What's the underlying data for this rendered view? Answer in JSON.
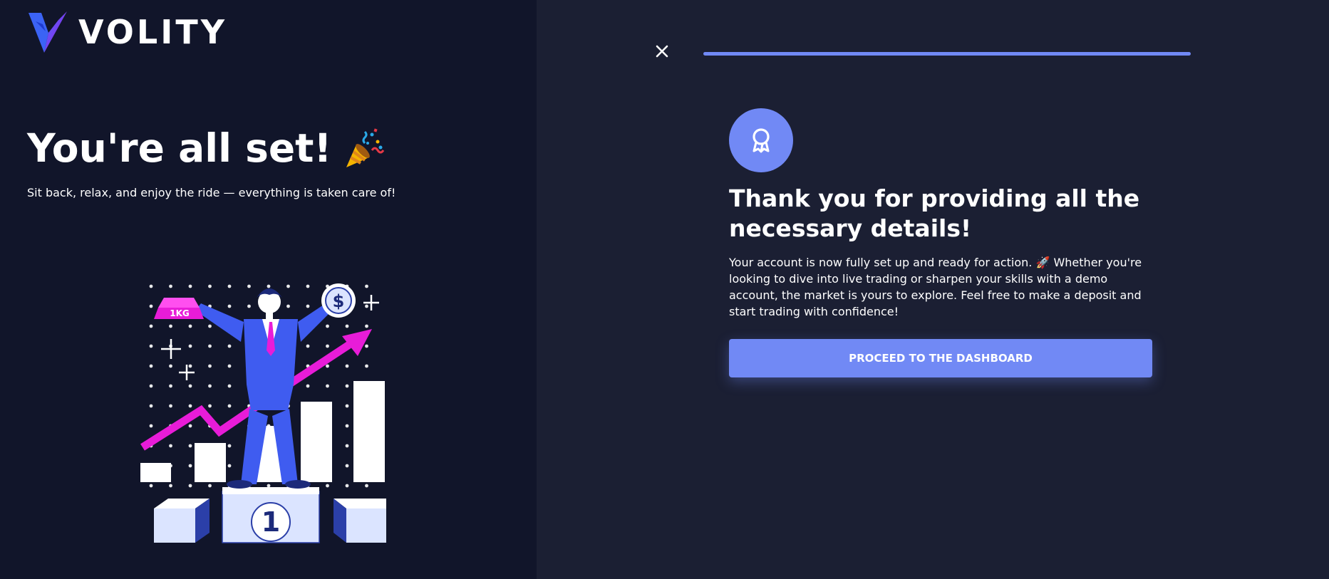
{
  "brand": {
    "name": "VOLITY"
  },
  "left": {
    "title": "You're all set!",
    "subtitle": "Sit back, relax, and enjoy the ride — everything is taken care of!",
    "illustration": {
      "gold_bar_label": "1KG",
      "coin_symbol": "$",
      "podium_number": "1"
    }
  },
  "onboarding": {
    "progress": 1.0,
    "close_icon": "close-icon",
    "badge_icon": "award-icon",
    "title": "Thank you for providing all the necessary details!",
    "body": "Your account is now fully set up and ready for action. 🚀 Whether you're looking to dive into live trading or sharpen your skills with a demo account, the market is yours to explore. Feel free to make a deposit and start trading with confidence!",
    "cta_label": "PROCEED TO THE DASHBOARD"
  },
  "colors": {
    "left_bg": "#11152a",
    "right_bg": "#1b1f33",
    "accent": "#7189f5",
    "magenta": "#e81cd8",
    "suit_blue": "#3f5cf0"
  }
}
